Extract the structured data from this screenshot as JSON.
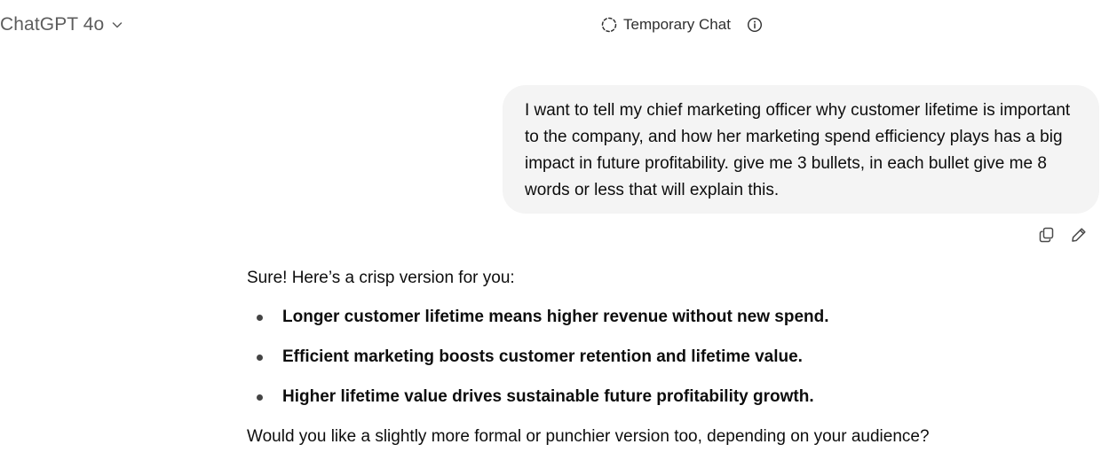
{
  "header": {
    "model_name": "ChatGPT 4o",
    "model_chevron_icon": "chevron-down-icon",
    "temp_chat_label": "Temporary Chat",
    "temp_chat_icon": "dashed-circle-icon",
    "info_icon": "info-icon"
  },
  "conversation": {
    "user_message": "I want to tell my chief marketing officer why customer lifetime is important to the company, and how her marketing spend efficiency plays has a big impact in future profitability. give me 3 bullets, in each bullet give me 8 words or less that will explain this.",
    "user_actions": {
      "copy_icon": "copy-icon",
      "edit_icon": "pencil-icon"
    },
    "assistant": {
      "intro": "Sure! Here’s a crisp version for you:",
      "bullets": [
        "Longer customer lifetime means higher revenue without new spend.",
        "Efficient marketing boosts customer retention and lifetime value.",
        "Higher lifetime value drives sustainable future profitability growth."
      ],
      "closing": "Would you like a slightly more formal or punchier version too, depending on your audience?"
    }
  },
  "colors": {
    "background": "#ffffff",
    "user_bubble": "#f4f4f4",
    "text": "#0d0d0d",
    "muted": "#5d5d5d"
  }
}
